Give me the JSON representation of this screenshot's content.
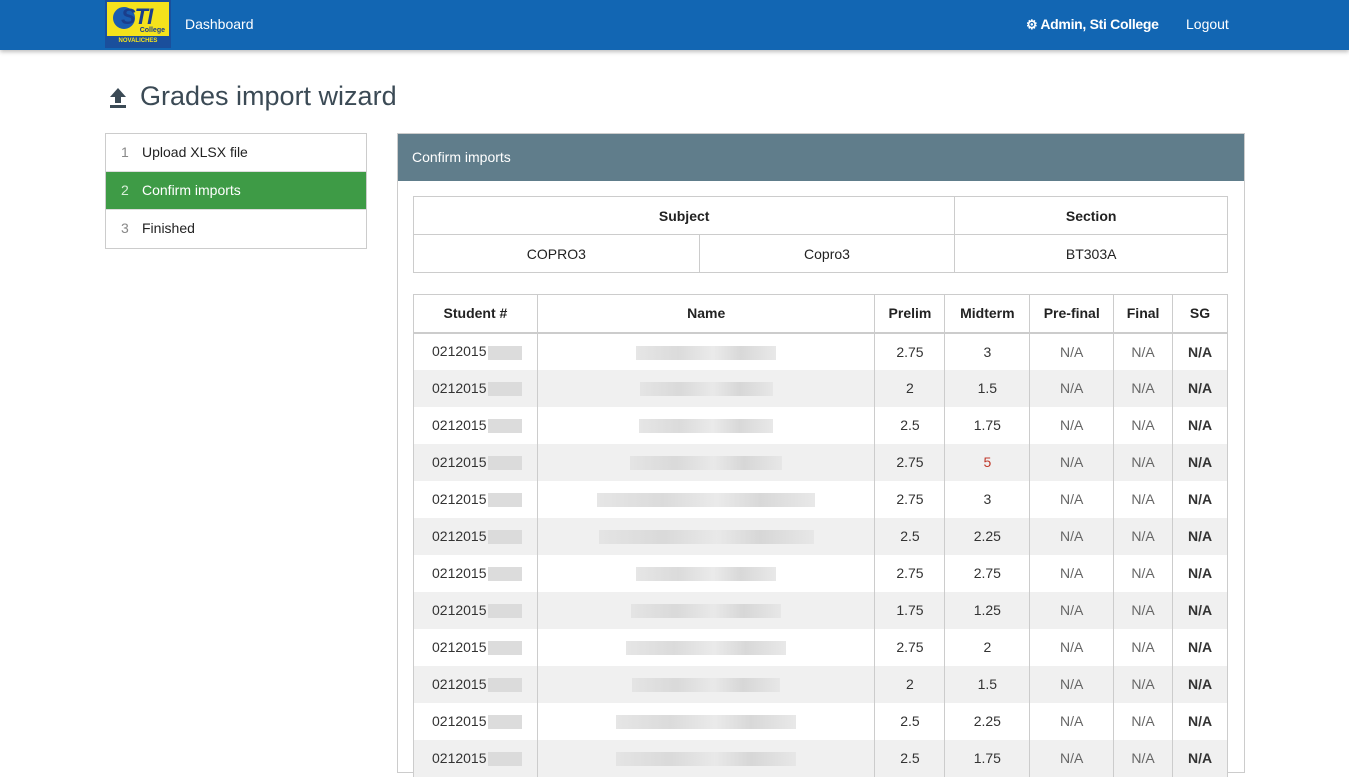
{
  "navbar": {
    "logo_text": "STI",
    "logo_college": "College",
    "logo_branch": "NOVALICHES",
    "dashboard": "Dashboard",
    "user": "Admin, Sti College",
    "logout": "Logout",
    "bg_color": "#1266b3"
  },
  "page": {
    "title": "Grades import wizard",
    "icon": "upload-icon"
  },
  "steps": [
    {
      "num": "1",
      "label": "Upload XLSX file",
      "active": false
    },
    {
      "num": "2",
      "label": "Confirm imports",
      "active": true
    },
    {
      "num": "3",
      "label": "Finished",
      "active": false
    }
  ],
  "panel": {
    "title": "Confirm imports",
    "header_color": "#607d8b"
  },
  "subject_table": {
    "headers": {
      "subject": "Subject",
      "section": "Section"
    },
    "row": {
      "code": "COPRO3",
      "name": "Copro3",
      "section": "BT303A"
    }
  },
  "grades_table": {
    "headers": [
      "Student #",
      "Name",
      "Prelim",
      "Midterm",
      "Pre-final",
      "Final",
      "SG"
    ],
    "rows": [
      {
        "student": "0212015",
        "prelim": "2.75",
        "midterm": "3",
        "prefinal": "N/A",
        "final": "N/A",
        "sg": "N/A"
      },
      {
        "student": "0212015",
        "prelim": "2",
        "midterm": "1.5",
        "prefinal": "N/A",
        "final": "N/A",
        "sg": "N/A"
      },
      {
        "student": "0212015",
        "prelim": "2.5",
        "midterm": "1.75",
        "prefinal": "N/A",
        "final": "N/A",
        "sg": "N/A"
      },
      {
        "student": "0212015",
        "prelim": "2.75",
        "midterm": "5",
        "prefinal": "N/A",
        "final": "N/A",
        "sg": "N/A"
      },
      {
        "student": "0212015",
        "prelim": "2.75",
        "midterm": "3",
        "prefinal": "N/A",
        "final": "N/A",
        "sg": "N/A"
      },
      {
        "student": "0212015",
        "prelim": "2.5",
        "midterm": "2.25",
        "prefinal": "N/A",
        "final": "N/A",
        "sg": "N/A"
      },
      {
        "student": "0212015",
        "prelim": "2.75",
        "midterm": "2.75",
        "prefinal": "N/A",
        "final": "N/A",
        "sg": "N/A"
      },
      {
        "student": "0212015",
        "prelim": "1.75",
        "midterm": "1.25",
        "prefinal": "N/A",
        "final": "N/A",
        "sg": "N/A"
      },
      {
        "student": "0212015",
        "prelim": "2.75",
        "midterm": "2",
        "prefinal": "N/A",
        "final": "N/A",
        "sg": "N/A"
      },
      {
        "student": "0212015",
        "prelim": "2",
        "midterm": "1.5",
        "prefinal": "N/A",
        "final": "N/A",
        "sg": "N/A"
      },
      {
        "student": "0212015",
        "prelim": "2.5",
        "midterm": "2.25",
        "prefinal": "N/A",
        "final": "N/A",
        "sg": "N/A"
      },
      {
        "student": "0212015",
        "prelim": "2.5",
        "midterm": "1.75",
        "prefinal": "N/A",
        "final": "N/A",
        "sg": "N/A"
      }
    ]
  }
}
